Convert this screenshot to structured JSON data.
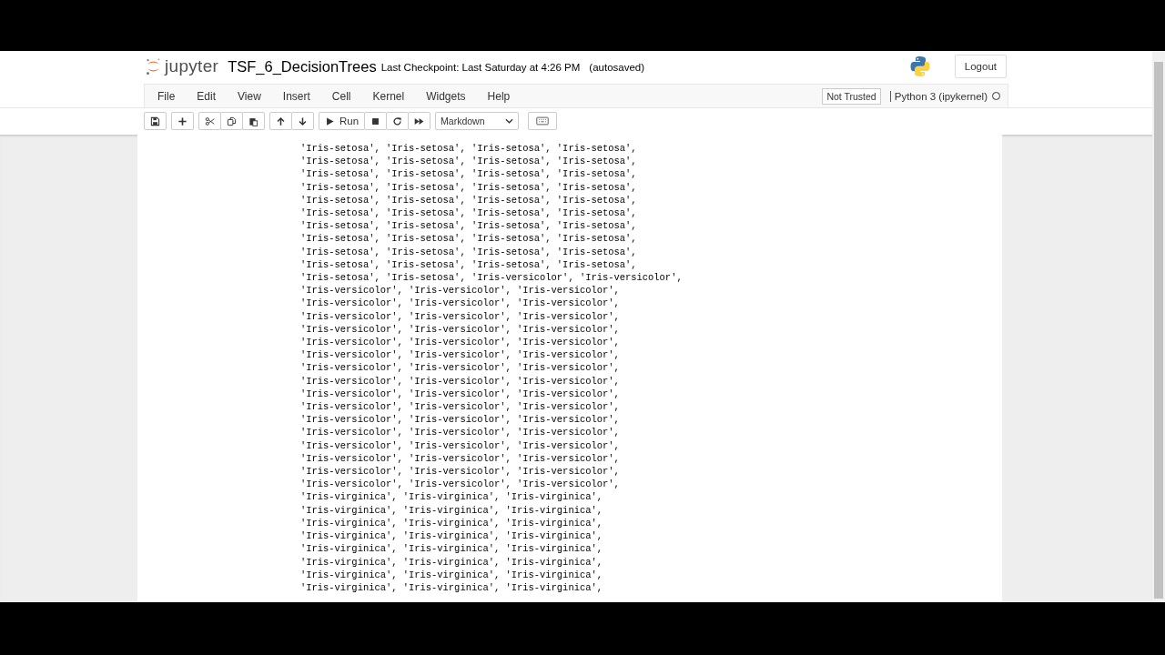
{
  "header": {
    "logo_text": "jupyter",
    "notebook_name": "TSF_6_DecisionTrees",
    "checkpoint": "Last Checkpoint: Last Saturday at 4:26 PM",
    "autosave": "(autosaved)",
    "logout": "Logout"
  },
  "menu": {
    "items": [
      "File",
      "Edit",
      "View",
      "Insert",
      "Cell",
      "Kernel",
      "Widgets",
      "Help"
    ],
    "trusted": "Not Trusted",
    "kernel": "Python 3 (ipykernel)",
    "kernel_busy": false
  },
  "toolbar": {
    "groups": [
      [
        {
          "kind": "save"
        }
      ],
      [
        {
          "kind": "plus"
        }
      ],
      [
        {
          "kind": "cut"
        },
        {
          "kind": "copy"
        },
        {
          "kind": "paste"
        }
      ],
      [
        {
          "kind": "up"
        },
        {
          "kind": "down"
        }
      ],
      [
        {
          "kind": "run",
          "label": "Run"
        },
        {
          "kind": "stop"
        },
        {
          "kind": "restart"
        },
        {
          "kind": "fastforward"
        }
      ]
    ],
    "cell_type": "Markdown"
  },
  "output": {
    "lines": [
      "'Iris-setosa', 'Iris-setosa', 'Iris-setosa', 'Iris-setosa',",
      "'Iris-setosa', 'Iris-setosa', 'Iris-setosa', 'Iris-setosa',",
      "'Iris-setosa', 'Iris-setosa', 'Iris-setosa', 'Iris-setosa',",
      "'Iris-setosa', 'Iris-setosa', 'Iris-setosa', 'Iris-setosa',",
      "'Iris-setosa', 'Iris-setosa', 'Iris-setosa', 'Iris-setosa',",
      "'Iris-setosa', 'Iris-setosa', 'Iris-setosa', 'Iris-setosa',",
      "'Iris-setosa', 'Iris-setosa', 'Iris-setosa', 'Iris-setosa',",
      "'Iris-setosa', 'Iris-setosa', 'Iris-setosa', 'Iris-setosa',",
      "'Iris-setosa', 'Iris-setosa', 'Iris-setosa', 'Iris-setosa',",
      "'Iris-setosa', 'Iris-setosa', 'Iris-setosa', 'Iris-setosa',",
      "'Iris-setosa', 'Iris-setosa', 'Iris-versicolor', 'Iris-versicolor',",
      "'Iris-versicolor', 'Iris-versicolor', 'Iris-versicolor',",
      "'Iris-versicolor', 'Iris-versicolor', 'Iris-versicolor',",
      "'Iris-versicolor', 'Iris-versicolor', 'Iris-versicolor',",
      "'Iris-versicolor', 'Iris-versicolor', 'Iris-versicolor',",
      "'Iris-versicolor', 'Iris-versicolor', 'Iris-versicolor',",
      "'Iris-versicolor', 'Iris-versicolor', 'Iris-versicolor',",
      "'Iris-versicolor', 'Iris-versicolor', 'Iris-versicolor',",
      "'Iris-versicolor', 'Iris-versicolor', 'Iris-versicolor',",
      "'Iris-versicolor', 'Iris-versicolor', 'Iris-versicolor',",
      "'Iris-versicolor', 'Iris-versicolor', 'Iris-versicolor',",
      "'Iris-versicolor', 'Iris-versicolor', 'Iris-versicolor',",
      "'Iris-versicolor', 'Iris-versicolor', 'Iris-versicolor',",
      "'Iris-versicolor', 'Iris-versicolor', 'Iris-versicolor',",
      "'Iris-versicolor', 'Iris-versicolor', 'Iris-versicolor',",
      "'Iris-versicolor', 'Iris-versicolor', 'Iris-versicolor',",
      "'Iris-versicolor', 'Iris-versicolor', 'Iris-versicolor',",
      "'Iris-virginica', 'Iris-virginica', 'Iris-virginica',",
      "'Iris-virginica', 'Iris-virginica', 'Iris-virginica',",
      "'Iris-virginica', 'Iris-virginica', 'Iris-virginica',",
      "'Iris-virginica', 'Iris-virginica', 'Iris-virginica',",
      "'Iris-virginica', 'Iris-virginica', 'Iris-virginica',",
      "'Iris-virginica', 'Iris-virginica', 'Iris-virginica',",
      "'Iris-virginica', 'Iris-virginica', 'Iris-virginica',",
      "'Iris-virginica', 'Iris-virginica', 'Iris-virginica',"
    ]
  }
}
